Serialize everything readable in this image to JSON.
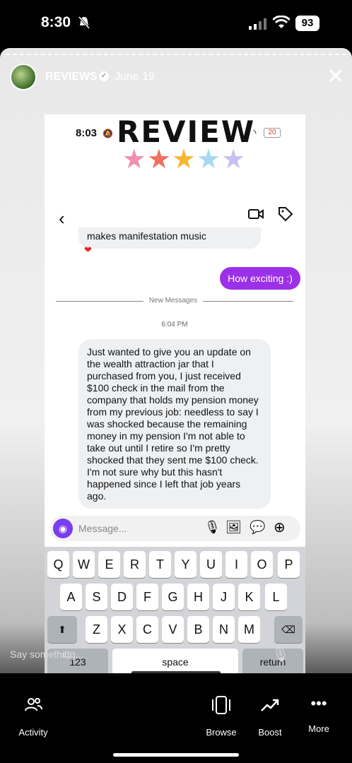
{
  "status": {
    "time": "8:30",
    "battery": "93"
  },
  "story": {
    "account": "REVIEWS",
    "date": "June 19",
    "reply_placeholder": "Say something..."
  },
  "sticker": {
    "text": "REVIEW",
    "stars": [
      "★",
      "★",
      "★",
      "★",
      "★"
    ],
    "star_colors": [
      "#f08fb0",
      "#f07060",
      "#f5b830",
      "#a8d8f0",
      "#c8c0f0"
    ]
  },
  "inner": {
    "status_time": "8:03",
    "battery": "20",
    "messages": {
      "prev_incoming": "makes manifestation music",
      "outgoing": "How exciting :)",
      "divider": "New Messages",
      "time": "6:04 PM",
      "incoming": "Just wanted to give you an update on the wealth attraction jar that I purchased from you, I just received $100 check in the mail from the company that holds my pension money from my previous job: needless to say I was shocked because the remaining money in my pension I'm not able to take out until I retire so I'm pretty shocked that they sent me $100 check. I'm not sure why but this hasn't happened since I left that job years ago."
    },
    "composer_placeholder": "Message...",
    "keyboard": {
      "row1": [
        "Q",
        "W",
        "E",
        "R",
        "T",
        "Y",
        "U",
        "I",
        "O",
        "P"
      ],
      "row2": [
        "A",
        "S",
        "D",
        "F",
        "G",
        "H",
        "J",
        "K",
        "L"
      ],
      "row3": [
        "Z",
        "X",
        "C",
        "V",
        "B",
        "N",
        "M"
      ],
      "numbers": "123",
      "space": "space",
      "return": "return"
    }
  },
  "nav": {
    "activity": "Activity",
    "browse": "Browse",
    "boost": "Boost",
    "more": "More"
  }
}
